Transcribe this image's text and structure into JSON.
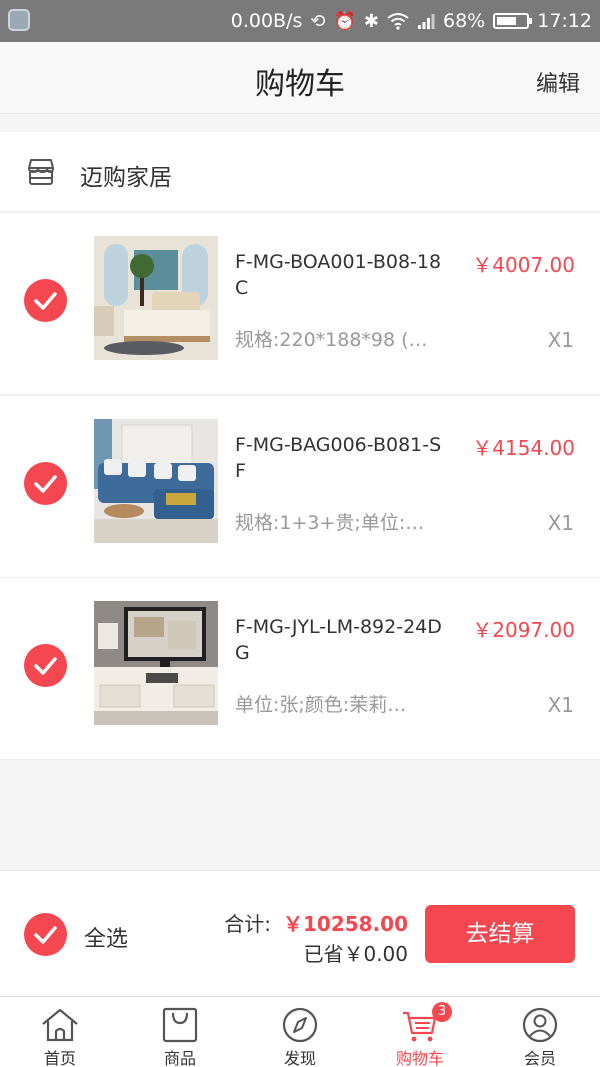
{
  "status_bar": {
    "net_speed": "0.00B/s",
    "battery_pct": "68%",
    "battery_level": 0.68,
    "time": "17:12"
  },
  "header": {
    "title": "购物车",
    "edit_label": "编辑"
  },
  "shop": {
    "name": "迈购家居",
    "icon": "store-icon"
  },
  "items": [
    {
      "name": "F-MG-BOA001-B08-18C",
      "price": "￥4007.00",
      "spec": "规格:220*188*98 (…",
      "qty": "X1",
      "checked": true,
      "image": "bedroom-bed-photo"
    },
    {
      "name": "F-MG-BAG006-B081-SF",
      "price": "￥4154.00",
      "spec": "规格:1+3+贵;单位:…",
      "qty": "X1",
      "checked": true,
      "image": "blue-sofa-photo"
    },
    {
      "name": "F-MG-JYL-LM-892-24DG",
      "price": "￥2097.00",
      "spec": "单位:张;颜色:茉莉…",
      "qty": "X1",
      "checked": true,
      "image": "tv-cabinet-photo"
    }
  ],
  "checkout": {
    "select_all_label": "全选",
    "total_label": "合计:",
    "total_amount": "￥10258.00",
    "saved_text": "已省￥0.00",
    "button_label": "去结算"
  },
  "tabbar": {
    "tabs": [
      {
        "label": "首页",
        "icon": "home-icon"
      },
      {
        "label": "商品",
        "icon": "shopping-bag-icon"
      },
      {
        "label": "发现",
        "icon": "compass-icon"
      },
      {
        "label": "购物车",
        "icon": "cart-icon",
        "badge": "3",
        "active": true
      },
      {
        "label": "会员",
        "icon": "user-icon"
      }
    ]
  },
  "colors": {
    "accent": "#f5474f",
    "background": "#f5f5f5"
  }
}
